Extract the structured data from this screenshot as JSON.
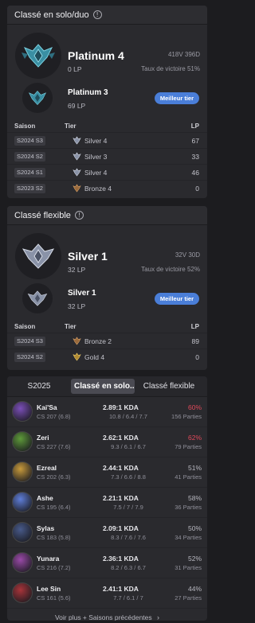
{
  "solo": {
    "title": "Classé en solo/duo",
    "tier": "Platinum 4",
    "lp": "0 LP",
    "wl": "418V 396D",
    "winrate": "Taux de victoire 51%",
    "peak": {
      "tier": "Platinum 3",
      "lp": "69 LP",
      "badge": "Meilleur tier"
    },
    "columns": {
      "season": "Saison",
      "tier": "Tier",
      "lp": "LP"
    },
    "history": [
      {
        "season": "S2024 S3",
        "tier": "Silver 4",
        "lp": "67",
        "icon": "silver-emblem-icon"
      },
      {
        "season": "S2024 S2",
        "tier": "Silver 3",
        "lp": "33",
        "icon": "silver-emblem-icon"
      },
      {
        "season": "S2024 S1",
        "tier": "Silver 4",
        "lp": "46",
        "icon": "silver-emblem-icon"
      },
      {
        "season": "S2023 S2",
        "tier": "Bronze 4",
        "lp": "0",
        "icon": "bronze-emblem-icon"
      }
    ]
  },
  "flex": {
    "title": "Classé flexible",
    "tier": "Silver 1",
    "lp": "32 LP",
    "wl": "32V 30D",
    "winrate": "Taux de victoire 52%",
    "peak": {
      "tier": "Silver 1",
      "lp": "32 LP",
      "badge": "Meilleur tier"
    },
    "columns": {
      "season": "Saison",
      "tier": "Tier",
      "lp": "LP"
    },
    "history": [
      {
        "season": "S2024 S3",
        "tier": "Bronze 2",
        "lp": "89",
        "icon": "bronze-emblem-icon"
      },
      {
        "season": "S2024 S2",
        "tier": "Gold 4",
        "lp": "0",
        "icon": "gold-emblem-icon"
      }
    ]
  },
  "champions": {
    "tabs": [
      "S2025",
      "Classé en solo...",
      "Classé flexible"
    ],
    "active_tab": 1,
    "rows": [
      {
        "name": "Kai'Sa",
        "cs": "CS 207 (6.8)",
        "kda": "2.89:1 KDA",
        "split": "10.8 / 6.4 / 7.7",
        "winrate": "60%",
        "games": "156 Parties",
        "hot": true,
        "color": "#7b4fb8"
      },
      {
        "name": "Zeri",
        "cs": "CS 227 (7.6)",
        "kda": "2.62:1 KDA",
        "split": "9.3 / 6.1 / 6.7",
        "winrate": "62%",
        "games": "79 Parties",
        "hot": true,
        "color": "#5e9a3a"
      },
      {
        "name": "Ezreal",
        "cs": "CS 202 (6.3)",
        "kda": "2.44:1 KDA",
        "split": "7.3 / 6.6 / 8.8",
        "winrate": "51%",
        "games": "41 Parties",
        "hot": false,
        "color": "#c79a3c"
      },
      {
        "name": "Ashe",
        "cs": "CS 195 (6.4)",
        "kda": "2.21:1 KDA",
        "split": "7.5 / 7 / 7.9",
        "winrate": "58%",
        "games": "36 Parties",
        "hot": false,
        "color": "#5f7ed8"
      },
      {
        "name": "Sylas",
        "cs": "CS 183 (5.8)",
        "kda": "2.09:1 KDA",
        "split": "8.3 / 7.6 / 7.6",
        "winrate": "50%",
        "games": "34 Parties",
        "hot": false,
        "color": "#485a8a"
      },
      {
        "name": "Yunara",
        "cs": "CS 216 (7.2)",
        "kda": "2.36:1 KDA",
        "split": "8.2 / 6.3 / 6.7",
        "winrate": "52%",
        "games": "31 Parties",
        "hot": false,
        "color": "#9a4aa8"
      },
      {
        "name": "Lee Sin",
        "cs": "CS 161 (5.6)",
        "kda": "2.41:1 KDA",
        "split": "7.7 / 6.1 / 7",
        "winrate": "44%",
        "games": "27 Parties",
        "hot": false,
        "color": "#a8343a"
      }
    ],
    "footer": "Voir plus + Saisons précédentes",
    "footer_icon": "chevron-right-icon"
  }
}
